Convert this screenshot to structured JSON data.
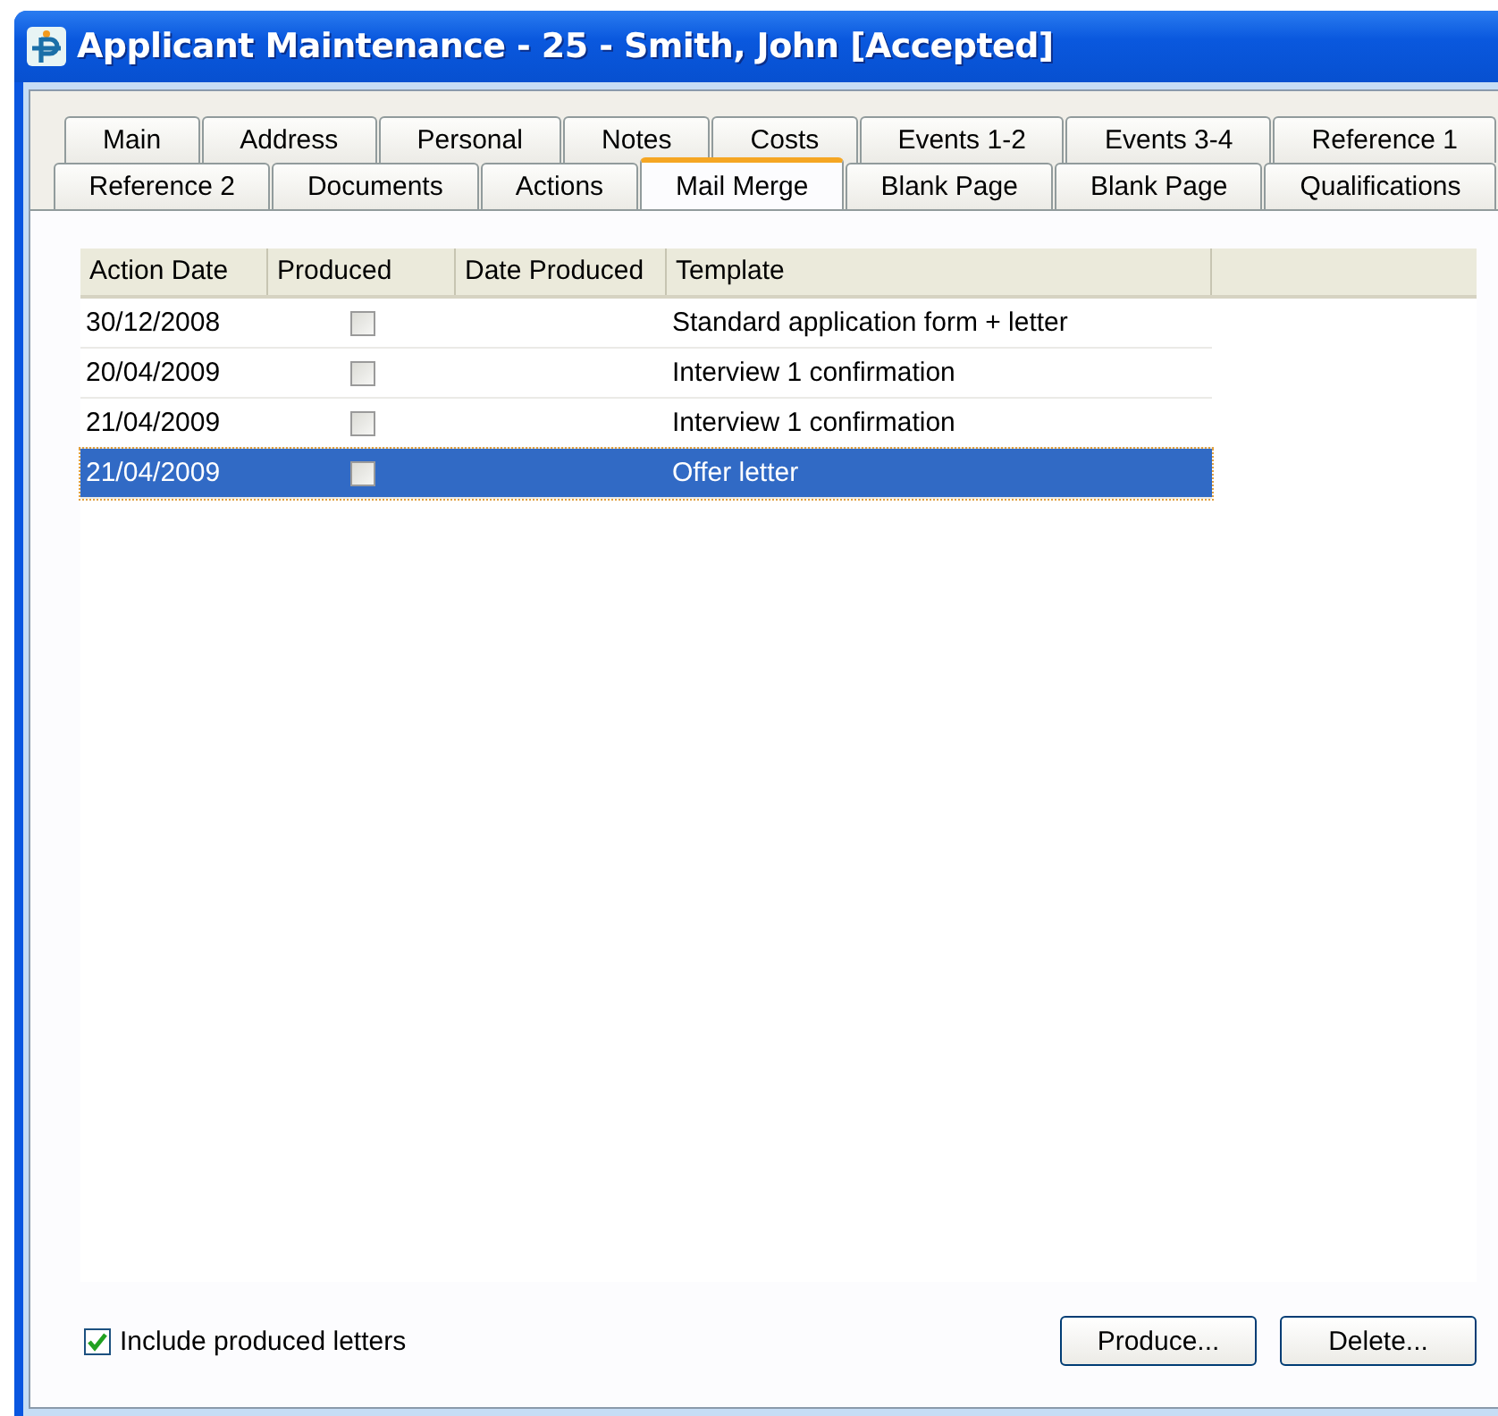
{
  "window": {
    "title": "Applicant Maintenance - 25 - Smith, John [Accepted]"
  },
  "tab_rows": [
    [
      {
        "label": "Main",
        "selected": false
      },
      {
        "label": "Address",
        "selected": false
      },
      {
        "label": "Personal",
        "selected": false
      },
      {
        "label": "Notes",
        "selected": false
      },
      {
        "label": "Costs",
        "selected": false
      },
      {
        "label": "Events 1-2",
        "selected": false
      },
      {
        "label": "Events 3-4",
        "selected": false
      },
      {
        "label": "Reference 1",
        "selected": false
      }
    ],
    [
      {
        "label": "Reference 2",
        "selected": false
      },
      {
        "label": "Documents",
        "selected": false
      },
      {
        "label": "Actions",
        "selected": false
      },
      {
        "label": "Mail Merge",
        "selected": true
      },
      {
        "label": "Blank Page",
        "selected": false
      },
      {
        "label": "Blank Page",
        "selected": false
      },
      {
        "label": "Qualifications",
        "selected": false
      }
    ]
  ],
  "table": {
    "columns": [
      "Action Date",
      "Produced",
      "Date Produced",
      "Template"
    ],
    "rows": [
      {
        "action_date": "30/12/2008",
        "produced": false,
        "template": "Standard application form + letter",
        "selected": false
      },
      {
        "action_date": "20/04/2009",
        "produced": false,
        "template": "Interview 1 confirmation",
        "selected": false
      },
      {
        "action_date": "21/04/2009",
        "produced": false,
        "template": "Interview 1 confirmation",
        "selected": false
      },
      {
        "action_date": "21/04/2009",
        "produced": false,
        "template": "Offer letter",
        "selected": true
      }
    ]
  },
  "include_produced": {
    "label": "Include produced letters",
    "checked": true
  },
  "buttons": [
    "Produce...",
    "Delete..."
  ]
}
